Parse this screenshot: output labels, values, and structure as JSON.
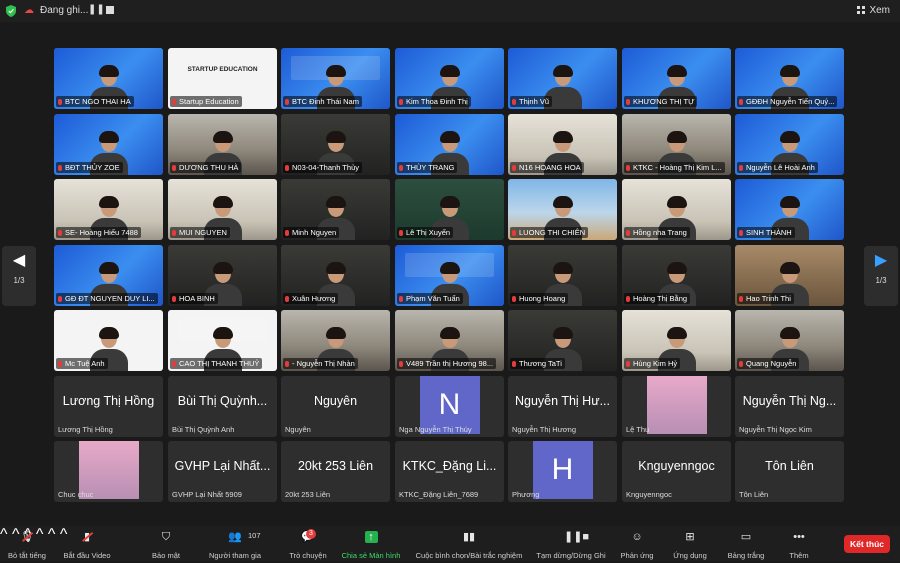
{
  "topbar": {
    "recording_label": "Đang ghi...",
    "view_label": "Xem"
  },
  "pager": {
    "left_page": "1/3",
    "right_page": "1/3"
  },
  "tiles": [
    {
      "name": "BTC NGO THAI HA",
      "bg": "blue",
      "active": true,
      "muted": true
    },
    {
      "name": "Startup Education",
      "bg": "white",
      "muted": true,
      "logo": "STARTUP EDUCATION"
    },
    {
      "name": "BTC Đinh Thái Nam",
      "bg": "blue",
      "muted": true,
      "banner": true
    },
    {
      "name": "Kim Thoa Đinh Thị",
      "bg": "blue",
      "muted": true
    },
    {
      "name": "Thịnh Vũ",
      "bg": "blue",
      "muted": true
    },
    {
      "name": "KHƯƠNG THỊ TỰ",
      "bg": "blue",
      "muted": true
    },
    {
      "name": "GĐĐH Nguyễn Tiến Quý...",
      "bg": "blue",
      "muted": true
    },
    {
      "name": "BĐT THỦY ZOE",
      "bg": "blue",
      "muted": true
    },
    {
      "name": "DƯƠNG THU HÀ",
      "bg": "room1",
      "muted": true
    },
    {
      "name": "N03-04-Thanh Thủy",
      "bg": "dark",
      "muted": true
    },
    {
      "name": "THÙY TRANG",
      "bg": "blue",
      "muted": true
    },
    {
      "name": "N16 HOANG HOA",
      "bg": "room2",
      "muted": true
    },
    {
      "name": "KTKC - Hoàng Thị Kim L...",
      "bg": "room1",
      "muted": true
    },
    {
      "name": "Nguyễn Lê Hoài Anh",
      "bg": "blue",
      "muted": true
    },
    {
      "name": "SE- Hoàng Hiếu 7488",
      "bg": "room2",
      "muted": true
    },
    {
      "name": "MUI NGUYEN",
      "bg": "room2",
      "muted": true
    },
    {
      "name": "Minh Nguyen",
      "bg": "dark",
      "muted": true
    },
    {
      "name": "Lê Thị Xuyến",
      "bg": "green",
      "muted": true
    },
    {
      "name": "LUONG THI CHIÊN",
      "bg": "beach",
      "muted": true
    },
    {
      "name": "Hồng  nha Trang",
      "bg": "room2",
      "muted": true
    },
    {
      "name": "SINH THÀNH",
      "bg": "blue",
      "muted": true
    },
    {
      "name": "GĐ ĐT NGUYEN DUY LI...",
      "bg": "blue",
      "muted": true
    },
    {
      "name": "HOA BINH",
      "bg": "dark",
      "muted": true
    },
    {
      "name": "Xuân Hương",
      "bg": "dark",
      "muted": true
    },
    {
      "name": "Phạm Văn Tuấn",
      "bg": "blue",
      "muted": true,
      "banner": true
    },
    {
      "name": "Huong Hoang",
      "bg": "dark",
      "muted": true
    },
    {
      "name": "Hoàng Thị Bằng",
      "bg": "dark",
      "muted": true
    },
    {
      "name": "Hao Trinh Thi",
      "bg": "warm",
      "muted": true
    },
    {
      "name": "Mc Tuệ Anh",
      "bg": "white",
      "muted": true
    },
    {
      "name": "CAO THỊ THANH THUỶ",
      "bg": "white",
      "muted": true,
      "banner": true
    },
    {
      "name": "- Nguyễn Thị Nhàn",
      "bg": "room1",
      "muted": true
    },
    {
      "name": "V489 Trần thị Hương 98...",
      "bg": "room1",
      "muted": true
    },
    {
      "name": "Thương TaTi",
      "bg": "dark",
      "muted": true
    },
    {
      "name": "Hùng Kim Hỷ",
      "bg": "room2",
      "muted": true
    },
    {
      "name": "Quang Nguyễn",
      "bg": "room1",
      "muted": true
    },
    {
      "name": "Lương Thị Hồng",
      "big": "Lương Thị Hồng",
      "type": "text"
    },
    {
      "name": "Bùi Thị Quỳnh Anh",
      "big": "Bùi Thị Quỳnh...",
      "type": "text"
    },
    {
      "name": "Nguyên",
      "big": "Nguyên",
      "type": "text"
    },
    {
      "name": "Nga Nguyễn Thị Thúy",
      "initial": "N",
      "type": "initial"
    },
    {
      "name": "Nguyễn Thị Hương",
      "big": "Nguyễn Thị Hư...",
      "type": "text"
    },
    {
      "name": "Lệ Thu",
      "type": "photo"
    },
    {
      "name": "Nguyễn Thị Ngọc Kim",
      "big": "Nguyễn Thị Ng...",
      "type": "text"
    },
    {
      "name": "Chuc chuc",
      "type": "photo"
    },
    {
      "name": "GVHP Lại Nhất 5909",
      "big": "GVHP Lại Nhất...",
      "type": "text"
    },
    {
      "name": "20kt 253 Liên",
      "big": "20kt 253 Liên",
      "type": "text"
    },
    {
      "name": "KTKC_Đặng Liên_7689",
      "big": "KTKC_Đặng Li...",
      "type": "text"
    },
    {
      "name": "Phương",
      "initial": "H",
      "type": "initial"
    },
    {
      "name": "Knguyenngoc",
      "big": "Knguyenngoc",
      "type": "text"
    },
    {
      "name": "Tôn Liên",
      "big": "Tôn Liên",
      "type": "text"
    }
  ],
  "toolbar": {
    "mute": "Bỏ tắt tiếng",
    "video": "Bắt đầu Video",
    "security": "Bảo mật",
    "participants": "Người tham gia",
    "participants_count": "107",
    "chat": "Trò chuyện",
    "chat_badge": "3",
    "share": "Chia sẻ Màn hình",
    "polls": "Cuộc bình chọn/Bài trắc nghiệm",
    "pause_record": "Tạm dừng/Dừng Ghi",
    "reactions": "Phản ứng",
    "apps": "Ứng dụng",
    "whiteboard": "Bảng trắng",
    "more": "Thêm",
    "end": "Kết thúc"
  }
}
